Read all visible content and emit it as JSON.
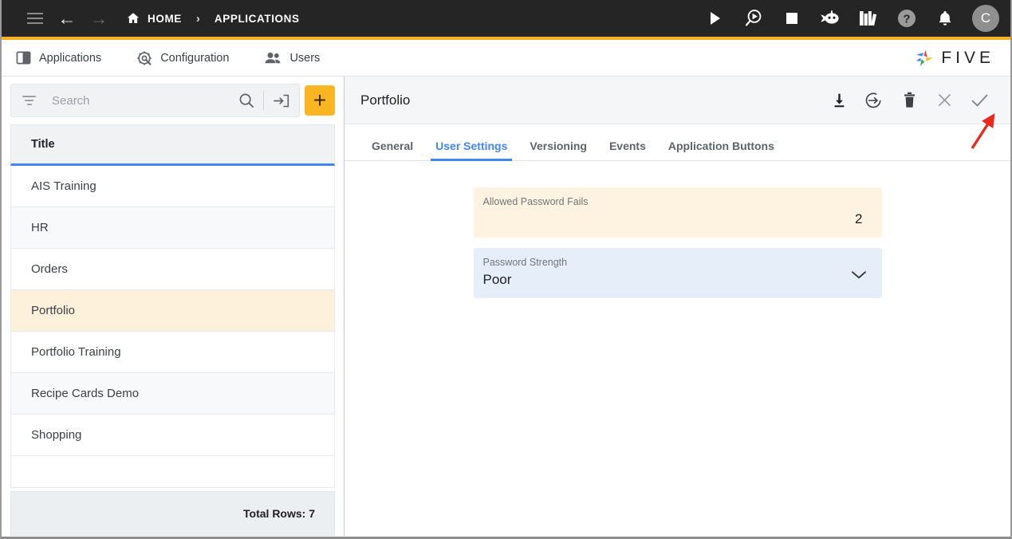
{
  "topbar": {
    "menu_icon": "hamburger-icon",
    "back_icon": "arrow-left-icon",
    "forward_icon": "arrow-right-icon",
    "home_icon": "home-icon",
    "breadcrumb": [
      {
        "label": "HOME"
      },
      {
        "label": "APPLICATIONS"
      }
    ],
    "separator": "›",
    "actions": [
      {
        "name": "run-icon",
        "title": "Run"
      },
      {
        "name": "debug-icon",
        "title": "Debug"
      },
      {
        "name": "stop-icon",
        "title": "Stop"
      },
      {
        "name": "chat-bot-icon",
        "title": "Assistant"
      },
      {
        "name": "library-icon",
        "title": "Library"
      },
      {
        "name": "help-icon",
        "title": "Help"
      },
      {
        "name": "notifications-bell-icon",
        "title": "Notifications"
      }
    ],
    "avatar_initial": "C"
  },
  "subnav": {
    "items": [
      {
        "label": "Applications",
        "icon": "applications-icon"
      },
      {
        "label": "Configuration",
        "icon": "configuration-gear-icon"
      },
      {
        "label": "Users",
        "icon": "users-icon"
      }
    ],
    "brand": "FIVE"
  },
  "search": {
    "placeholder": "Search",
    "value": "",
    "filter_icon": "filter-icon",
    "search_icon": "search-icon",
    "import_icon": "import-icon",
    "add_label": "+"
  },
  "list": {
    "header": "Title",
    "rows": [
      {
        "title": "AIS Training",
        "selected": false
      },
      {
        "title": "HR",
        "selected": false
      },
      {
        "title": "Orders",
        "selected": false
      },
      {
        "title": "Portfolio",
        "selected": true
      },
      {
        "title": "Portfolio Training",
        "selected": false
      },
      {
        "title": "Recipe Cards Demo",
        "selected": false
      },
      {
        "title": "Shopping",
        "selected": false
      }
    ],
    "footer": "Total Rows: 7"
  },
  "record": {
    "title": "Portfolio",
    "actions": [
      {
        "name": "download-icon",
        "title": "Download"
      },
      {
        "name": "deploy-icon",
        "title": "Deploy"
      },
      {
        "name": "delete-icon",
        "title": "Delete"
      },
      {
        "name": "close-icon",
        "title": "Close"
      },
      {
        "name": "save-check-icon",
        "title": "Save"
      }
    ],
    "tabs": [
      {
        "label": "General",
        "active": false
      },
      {
        "label": "User Settings",
        "active": true
      },
      {
        "label": "Versioning",
        "active": false
      },
      {
        "label": "Events",
        "active": false
      },
      {
        "label": "Application Buttons",
        "active": false
      }
    ],
    "fields": [
      {
        "label": "Allowed Password Fails",
        "value": "2",
        "style": "amber",
        "control": "number"
      },
      {
        "label": "Password Strength",
        "value": "Poor",
        "style": "blue",
        "control": "select",
        "chevron_icon": "chevron-down-icon"
      }
    ]
  },
  "colors": {
    "topbar_bg": "#252526",
    "accent_amber": "#f5b323",
    "accent_blue": "#4285f4",
    "selected_row": "#fdf1dc",
    "field_amber": "#fdf3e0",
    "field_blue": "#e6eff9",
    "annotation_red": "#e8291c"
  },
  "annotation": {
    "type": "arrow",
    "color": "#e8291c",
    "points_to": "save-check-icon"
  }
}
